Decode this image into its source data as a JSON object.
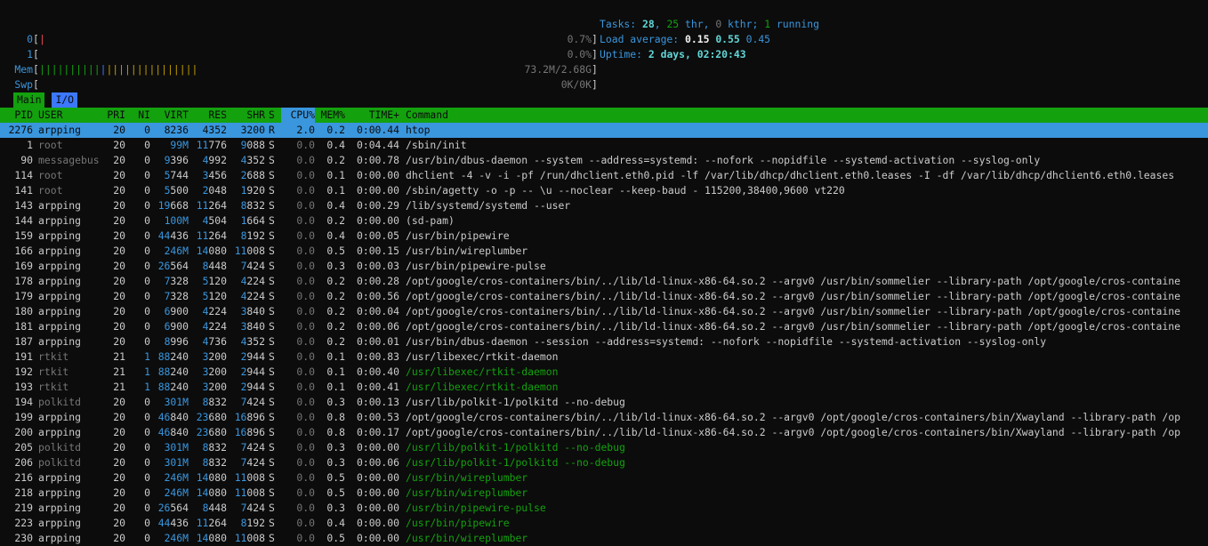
{
  "meters": {
    "cpu0": {
      "label": "0",
      "bar": "|",
      "value": "0.7%"
    },
    "cpu1": {
      "label": "1",
      "bar": "",
      "value": "0.0%"
    },
    "mem": {
      "label": "Mem",
      "bar": "||||||||||||||||||||||||||",
      "value": "73.2M/2.68G"
    },
    "swp": {
      "label": "Swp",
      "bar": "",
      "value": "0K/0K"
    }
  },
  "info": {
    "tasks_label": "Tasks: ",
    "tasks": "28",
    "thr": "25",
    "thr_label": " thr, ",
    "kthr": "0",
    "kthr_label": " kthr; ",
    "running": "1",
    "running_label": " running",
    "load_label": "Load average: ",
    "load1": "0.15",
    "load5": "0.55",
    "load15": "0.45",
    "uptime_label": "Uptime: ",
    "uptime": "2 days, 02:20:43"
  },
  "tabs": [
    {
      "label": "Main"
    },
    {
      "label": "I/O"
    }
  ],
  "columns": {
    "pid": "PID",
    "user": "USER",
    "pri": "PRI",
    "ni": "NI",
    "virt": "VIRT",
    "res": "RES",
    "shr": "SHR",
    "s": "S",
    "cpu": "CPU%",
    "mem": "MEM%",
    "time": "TIME+",
    "cmd": "Command"
  },
  "processes": [
    {
      "pid": "2276",
      "user": "arpping",
      "pri": "20",
      "ni": "0",
      "virt": "8236",
      "res": "4352",
      "shr": "3200",
      "s": "R",
      "cpu": "2.0",
      "mem": "0.2",
      "time": "0:00.44",
      "cmd": "htop",
      "selected": true
    },
    {
      "pid": "1",
      "user": "root",
      "pri": "20",
      "ni": "0",
      "virt": "99M",
      "res": "11776",
      "shr": "9088",
      "s": "S",
      "cpu": "0.0",
      "mem": "0.4",
      "time": "0:04.44",
      "cmd": "/sbin/init"
    },
    {
      "pid": "90",
      "user": "messagebus",
      "pri": "20",
      "ni": "0",
      "virt": "9396",
      "res": "4992",
      "shr": "4352",
      "s": "S",
      "cpu": "0.0",
      "mem": "0.2",
      "time": "0:00.78",
      "cmd": "/usr/bin/dbus-daemon --system --address=systemd: --nofork --nopidfile --systemd-activation --syslog-only"
    },
    {
      "pid": "114",
      "user": "root",
      "pri": "20",
      "ni": "0",
      "virt": "5744",
      "res": "3456",
      "shr": "2688",
      "s": "S",
      "cpu": "0.0",
      "mem": "0.1",
      "time": "0:00.00",
      "cmd": "dhclient -4 -v -i -pf /run/dhclient.eth0.pid -lf /var/lib/dhcp/dhclient.eth0.leases -I -df /var/lib/dhcp/dhclient6.eth0.leases"
    },
    {
      "pid": "141",
      "user": "root",
      "pri": "20",
      "ni": "0",
      "virt": "5500",
      "res": "2048",
      "shr": "1920",
      "s": "S",
      "cpu": "0.0",
      "mem": "0.1",
      "time": "0:00.00",
      "cmd": "/sbin/agetty -o -p -- \\u --noclear --keep-baud - 115200,38400,9600 vt220"
    },
    {
      "pid": "143",
      "user": "arpping",
      "pri": "20",
      "ni": "0",
      "virt": "19668",
      "res": "11264",
      "shr": "8832",
      "s": "S",
      "cpu": "0.0",
      "mem": "0.4",
      "time": "0:00.29",
      "cmd": "/lib/systemd/systemd --user"
    },
    {
      "pid": "144",
      "user": "arpping",
      "pri": "20",
      "ni": "0",
      "virt": "100M",
      "res": "4504",
      "shr": "1664",
      "s": "S",
      "cpu": "0.0",
      "mem": "0.2",
      "time": "0:00.00",
      "cmd": "(sd-pam)"
    },
    {
      "pid": "159",
      "user": "arpping",
      "pri": "20",
      "ni": "0",
      "virt": "44436",
      "res": "11264",
      "shr": "8192",
      "s": "S",
      "cpu": "0.0",
      "mem": "0.4",
      "time": "0:00.05",
      "cmd": "/usr/bin/pipewire"
    },
    {
      "pid": "166",
      "user": "arpping",
      "pri": "20",
      "ni": "0",
      "virt": "246M",
      "res": "14080",
      "shr": "11008",
      "s": "S",
      "cpu": "0.0",
      "mem": "0.5",
      "time": "0:00.15",
      "cmd": "/usr/bin/wireplumber"
    },
    {
      "pid": "169",
      "user": "arpping",
      "pri": "20",
      "ni": "0",
      "virt": "26564",
      "res": "8448",
      "shr": "7424",
      "s": "S",
      "cpu": "0.0",
      "mem": "0.3",
      "time": "0:00.03",
      "cmd": "/usr/bin/pipewire-pulse"
    },
    {
      "pid": "178",
      "user": "arpping",
      "pri": "20",
      "ni": "0",
      "virt": "7328",
      "res": "5120",
      "shr": "4224",
      "s": "S",
      "cpu": "0.0",
      "mem": "0.2",
      "time": "0:00.28",
      "cmd": "/opt/google/cros-containers/bin/../lib/ld-linux-x86-64.so.2 --argv0 /usr/bin/sommelier --library-path /opt/google/cros-containe"
    },
    {
      "pid": "179",
      "user": "arpping",
      "pri": "20",
      "ni": "0",
      "virt": "7328",
      "res": "5120",
      "shr": "4224",
      "s": "S",
      "cpu": "0.0",
      "mem": "0.2",
      "time": "0:00.56",
      "cmd": "/opt/google/cros-containers/bin/../lib/ld-linux-x86-64.so.2 --argv0 /usr/bin/sommelier --library-path /opt/google/cros-containe"
    },
    {
      "pid": "180",
      "user": "arpping",
      "pri": "20",
      "ni": "0",
      "virt": "6900",
      "res": "4224",
      "shr": "3840",
      "s": "S",
      "cpu": "0.0",
      "mem": "0.2",
      "time": "0:00.04",
      "cmd": "/opt/google/cros-containers/bin/../lib/ld-linux-x86-64.so.2 --argv0 /usr/bin/sommelier --library-path /opt/google/cros-containe"
    },
    {
      "pid": "181",
      "user": "arpping",
      "pri": "20",
      "ni": "0",
      "virt": "6900",
      "res": "4224",
      "shr": "3840",
      "s": "S",
      "cpu": "0.0",
      "mem": "0.2",
      "time": "0:00.06",
      "cmd": "/opt/google/cros-containers/bin/../lib/ld-linux-x86-64.so.2 --argv0 /usr/bin/sommelier --library-path /opt/google/cros-containe"
    },
    {
      "pid": "187",
      "user": "arpping",
      "pri": "20",
      "ni": "0",
      "virt": "8996",
      "res": "4736",
      "shr": "4352",
      "s": "S",
      "cpu": "0.0",
      "mem": "0.2",
      "time": "0:00.01",
      "cmd": "/usr/bin/dbus-daemon --session --address=systemd: --nofork --nopidfile --systemd-activation --syslog-only"
    },
    {
      "pid": "191",
      "user": "rtkit",
      "pri": "21",
      "ni": "1",
      "virt": "88240",
      "res": "3200",
      "shr": "2944",
      "s": "S",
      "cpu": "0.0",
      "mem": "0.1",
      "time": "0:00.83",
      "cmd": "/usr/libexec/rtkit-daemon"
    },
    {
      "pid": "192",
      "user": "rtkit",
      "pri": "21",
      "ni": "1",
      "virt": "88240",
      "res": "3200",
      "shr": "2944",
      "s": "S",
      "cpu": "0.0",
      "mem": "0.1",
      "time": "0:00.40",
      "cmd": "/usr/libexec/rtkit-daemon",
      "thread": true
    },
    {
      "pid": "193",
      "user": "rtkit",
      "pri": "21",
      "ni": "1",
      "virt": "88240",
      "res": "3200",
      "shr": "2944",
      "s": "S",
      "cpu": "0.0",
      "mem": "0.1",
      "time": "0:00.41",
      "cmd": "/usr/libexec/rtkit-daemon",
      "thread": true
    },
    {
      "pid": "194",
      "user": "polkitd",
      "pri": "20",
      "ni": "0",
      "virt": "301M",
      "res": "8832",
      "shr": "7424",
      "s": "S",
      "cpu": "0.0",
      "mem": "0.3",
      "time": "0:00.13",
      "cmd": "/usr/lib/polkit-1/polkitd --no-debug"
    },
    {
      "pid": "199",
      "user": "arpping",
      "pri": "20",
      "ni": "0",
      "virt": "46840",
      "res": "23680",
      "shr": "16896",
      "s": "S",
      "cpu": "0.0",
      "mem": "0.8",
      "time": "0:00.53",
      "cmd": "/opt/google/cros-containers/bin/../lib/ld-linux-x86-64.so.2 --argv0 /opt/google/cros-containers/bin/Xwayland --library-path /op"
    },
    {
      "pid": "200",
      "user": "arpping",
      "pri": "20",
      "ni": "0",
      "virt": "46840",
      "res": "23680",
      "shr": "16896",
      "s": "S",
      "cpu": "0.0",
      "mem": "0.8",
      "time": "0:00.17",
      "cmd": "/opt/google/cros-containers/bin/../lib/ld-linux-x86-64.so.2 --argv0 /opt/google/cros-containers/bin/Xwayland --library-path /op"
    },
    {
      "pid": "205",
      "user": "polkitd",
      "pri": "20",
      "ni": "0",
      "virt": "301M",
      "res": "8832",
      "shr": "7424",
      "s": "S",
      "cpu": "0.0",
      "mem": "0.3",
      "time": "0:00.00",
      "cmd": "/usr/lib/polkit-1/polkitd --no-debug",
      "thread": true
    },
    {
      "pid": "206",
      "user": "polkitd",
      "pri": "20",
      "ni": "0",
      "virt": "301M",
      "res": "8832",
      "shr": "7424",
      "s": "S",
      "cpu": "0.0",
      "mem": "0.3",
      "time": "0:00.06",
      "cmd": "/usr/lib/polkit-1/polkitd --no-debug",
      "thread": true
    },
    {
      "pid": "216",
      "user": "arpping",
      "pri": "20",
      "ni": "0",
      "virt": "246M",
      "res": "14080",
      "shr": "11008",
      "s": "S",
      "cpu": "0.0",
      "mem": "0.5",
      "time": "0:00.00",
      "cmd": "/usr/bin/wireplumber",
      "thread": true
    },
    {
      "pid": "218",
      "user": "arpping",
      "pri": "20",
      "ni": "0",
      "virt": "246M",
      "res": "14080",
      "shr": "11008",
      "s": "S",
      "cpu": "0.0",
      "mem": "0.5",
      "time": "0:00.00",
      "cmd": "/usr/bin/wireplumber",
      "thread": true
    },
    {
      "pid": "219",
      "user": "arpping",
      "pri": "20",
      "ni": "0",
      "virt": "26564",
      "res": "8448",
      "shr": "7424",
      "s": "S",
      "cpu": "0.0",
      "mem": "0.3",
      "time": "0:00.00",
      "cmd": "/usr/bin/pipewire-pulse",
      "thread": true
    },
    {
      "pid": "223",
      "user": "arpping",
      "pri": "20",
      "ni": "0",
      "virt": "44436",
      "res": "11264",
      "shr": "8192",
      "s": "S",
      "cpu": "0.0",
      "mem": "0.4",
      "time": "0:00.00",
      "cmd": "/usr/bin/pipewire",
      "thread": true
    },
    {
      "pid": "230",
      "user": "arpping",
      "pri": "20",
      "ni": "0",
      "virt": "246M",
      "res": "14080",
      "shr": "11008",
      "s": "S",
      "cpu": "0.0",
      "mem": "0.5",
      "time": "0:00.00",
      "cmd": "/usr/bin/wireplumber",
      "thread": true
    }
  ]
}
